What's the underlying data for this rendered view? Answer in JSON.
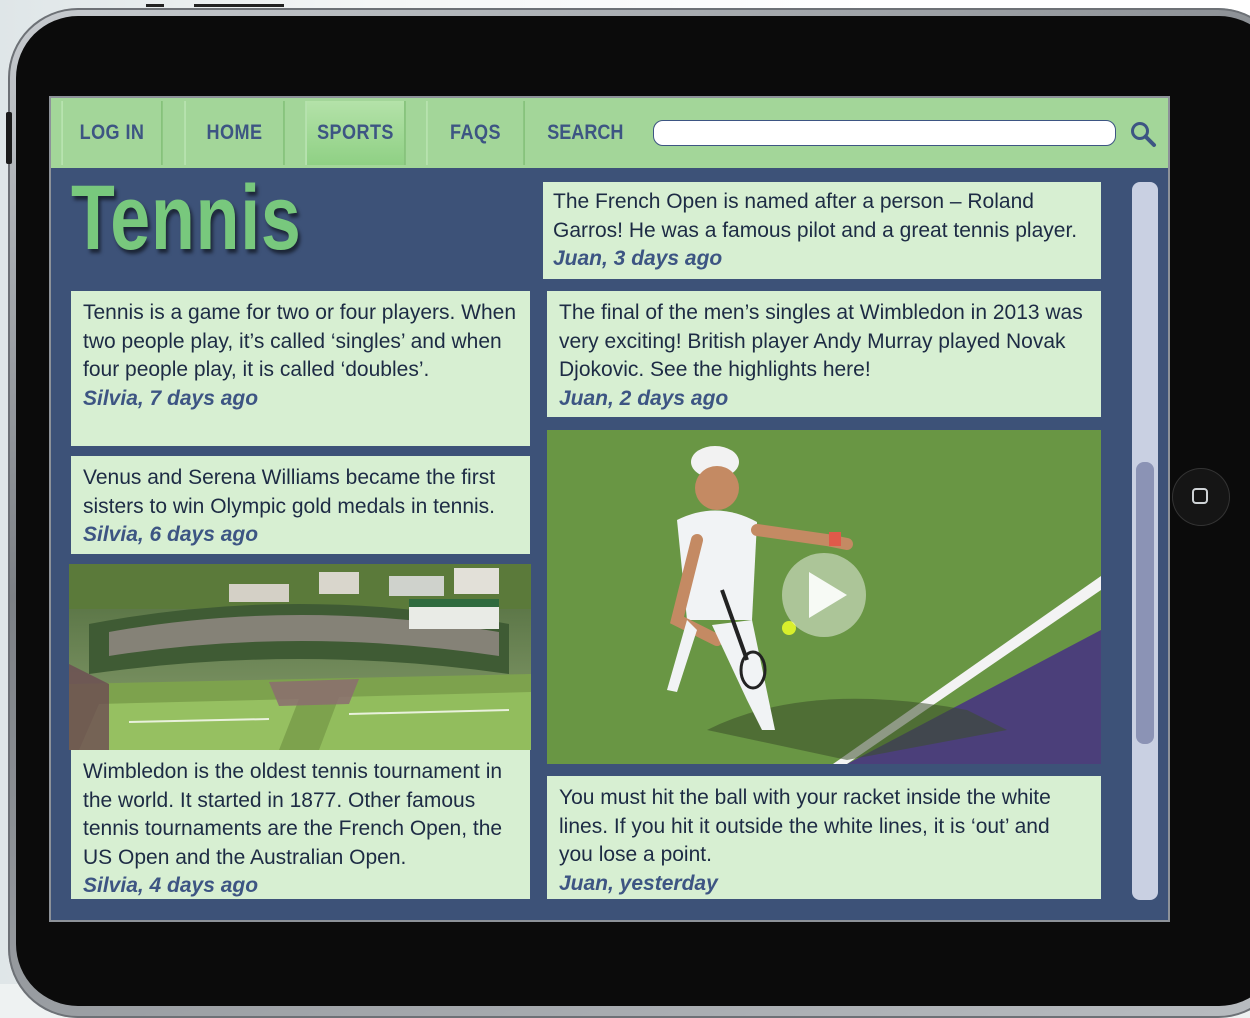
{
  "nav": {
    "tabs": [
      {
        "label": "LOG IN"
      },
      {
        "label": "HOME"
      },
      {
        "label": "SPORTS",
        "active": true
      },
      {
        "label": "FAQS"
      }
    ],
    "search_label": "SEARCH",
    "search_value": ""
  },
  "page": {
    "title": "Tennis"
  },
  "posts": [
    {
      "body": "The French Open is named after a person – Roland Garros! He was a famous pilot and a great tennis player.",
      "meta": "Juan, 3 days ago"
    },
    {
      "body": "Tennis is a game for two or four players. When two people play, it’s called ‘singles’ and when four people play, it is called ‘doubles’.",
      "meta": "Silvia, 7 days ago"
    },
    {
      "body": "The final of the men’s singles at Wimbledon in 2013 was very exciting! British player Andy Murray played Novak Djokovic. See the highlights here!",
      "meta": "Juan, 2 days ago"
    },
    {
      "body": "Venus and Serena Williams became the first sisters to win Olympic gold medals in tennis.",
      "meta": "Silvia, 6 days ago"
    },
    {
      "body": "Wimbledon is the oldest tennis tournament in the world. It started in 1877. Other famous tennis tournaments are the French Open, the US Open and the Australian Open.",
      "meta": "Silvia, 4 days ago"
    },
    {
      "body": "You must hit the ball with your racket inside the white lines. If you hit it outside the white lines, it is ‘out’ and you lose a point.",
      "meta": "Juan, yesterday"
    }
  ],
  "media": {
    "stadium_photo": "wimbledon-stadium-photo",
    "video": "tennis-highlights-video",
    "play_icon": "play-icon"
  },
  "colors": {
    "navbar": "#a3d699",
    "nav_text": "#3d5583",
    "screen_bg": "#3d5278",
    "post_bg": "#d7efd2",
    "title": "#78c87d"
  }
}
